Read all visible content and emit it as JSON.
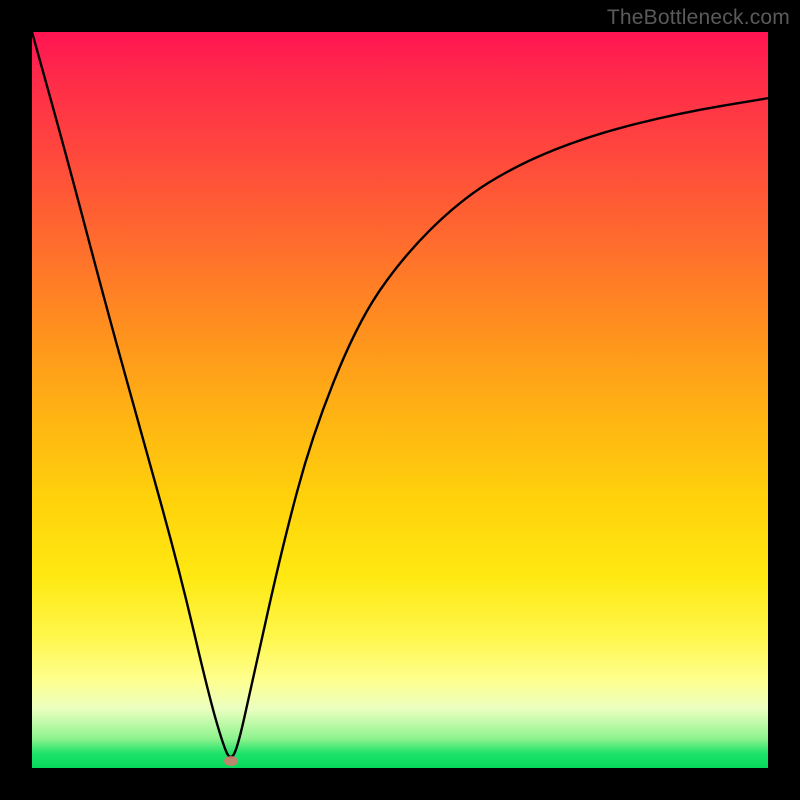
{
  "watermark": "TheBottleneck.com",
  "chart_data": {
    "type": "line",
    "title": "",
    "xlabel": "",
    "ylabel": "",
    "xlim": [
      0,
      100
    ],
    "ylim": [
      0,
      100
    ],
    "grid": false,
    "legend": false,
    "series": [
      {
        "name": "curve",
        "x": [
          0,
          5,
          10,
          15,
          20,
          24,
          26,
          27,
          28,
          30,
          34,
          38,
          44,
          50,
          58,
          66,
          76,
          88,
          100
        ],
        "y": [
          100,
          82,
          63,
          45,
          27,
          10,
          3,
          1,
          3,
          12,
          30,
          45,
          60,
          69,
          77,
          82,
          86,
          89,
          91
        ]
      }
    ],
    "marker": {
      "x": 27,
      "y": 1
    },
    "colors": {
      "curve": "#000000",
      "marker": "#d8796f",
      "frame": "#000000"
    }
  }
}
